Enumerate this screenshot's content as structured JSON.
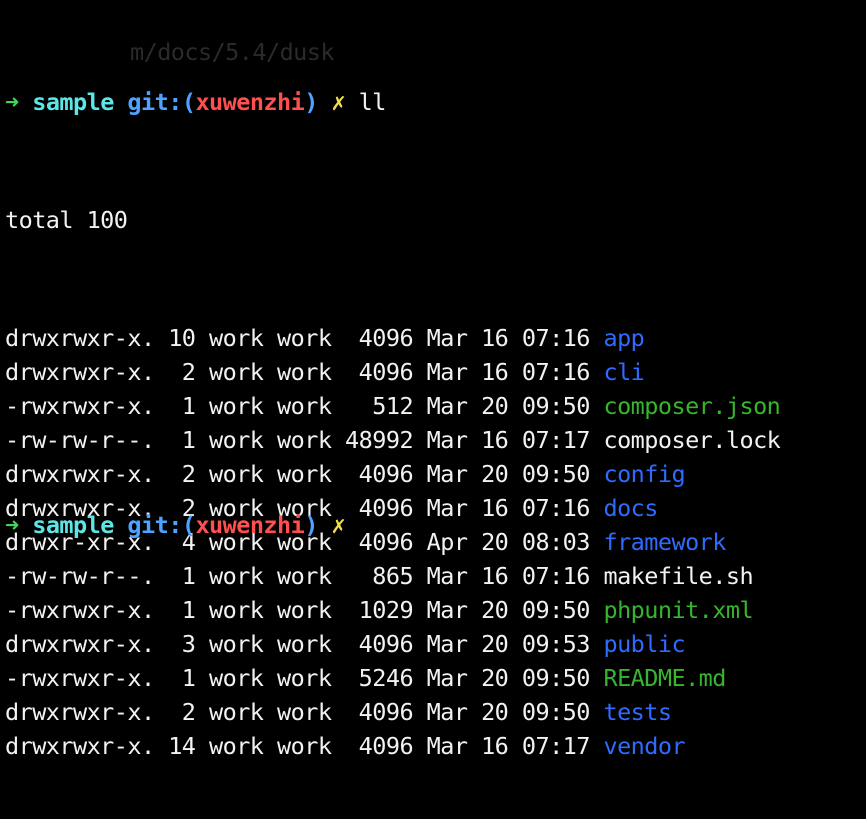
{
  "terminal": {
    "prompt": {
      "arrow": "➜",
      "dir": "sample",
      "git_label": "git:",
      "paren_open": "(",
      "branch": "xuwenzhi",
      "paren_close": ")",
      "dirty_marker": "✗",
      "command": "ll"
    },
    "total_line": "total 100",
    "ghost_text": "m/docs/5.4/dusk",
    "listing": [
      {
        "perm": "drwxrwxr-x.",
        "links": "10",
        "owner": "work",
        "group": "work",
        "size": "4096",
        "month": "Mar",
        "day": "16",
        "time": "07:16",
        "name": "app",
        "type": "dir"
      },
      {
        "perm": "drwxrwxr-x.",
        "links": "2",
        "owner": "work",
        "group": "work",
        "size": "4096",
        "month": "Mar",
        "day": "16",
        "time": "07:16",
        "name": "cli",
        "type": "dir"
      },
      {
        "perm": "-rwxrwxr-x.",
        "links": "1",
        "owner": "work",
        "group": "work",
        "size": "512",
        "month": "Mar",
        "day": "20",
        "time": "09:50",
        "name": "composer.json",
        "type": "exec"
      },
      {
        "perm": "-rw-rw-r--.",
        "links": "1",
        "owner": "work",
        "group": "work",
        "size": "48992",
        "month": "Mar",
        "day": "16",
        "time": "07:17",
        "name": "composer.lock",
        "type": "file"
      },
      {
        "perm": "drwxrwxr-x.",
        "links": "2",
        "owner": "work",
        "group": "work",
        "size": "4096",
        "month": "Mar",
        "day": "20",
        "time": "09:50",
        "name": "config",
        "type": "dir"
      },
      {
        "perm": "drwxrwxr-x.",
        "links": "2",
        "owner": "work",
        "group": "work",
        "size": "4096",
        "month": "Mar",
        "day": "16",
        "time": "07:16",
        "name": "docs",
        "type": "dir"
      },
      {
        "perm": "drwxr-xr-x.",
        "links": "4",
        "owner": "work",
        "group": "work",
        "size": "4096",
        "month": "Apr",
        "day": "20",
        "time": "08:03",
        "name": "framework",
        "type": "dir"
      },
      {
        "perm": "-rw-rw-r--.",
        "links": "1",
        "owner": "work",
        "group": "work",
        "size": "865",
        "month": "Mar",
        "day": "16",
        "time": "07:16",
        "name": "makefile.sh",
        "type": "file"
      },
      {
        "perm": "-rwxrwxr-x.",
        "links": "1",
        "owner": "work",
        "group": "work",
        "size": "1029",
        "month": "Mar",
        "day": "20",
        "time": "09:50",
        "name": "phpunit.xml",
        "type": "exec"
      },
      {
        "perm": "drwxrwxr-x.",
        "links": "3",
        "owner": "work",
        "group": "work",
        "size": "4096",
        "month": "Mar",
        "day": "20",
        "time": "09:53",
        "name": "public",
        "type": "dir"
      },
      {
        "perm": "-rwxrwxr-x.",
        "links": "1",
        "owner": "work",
        "group": "work",
        "size": "5246",
        "month": "Mar",
        "day": "20",
        "time": "09:50",
        "name": "README.md",
        "type": "exec"
      },
      {
        "perm": "drwxrwxr-x.",
        "links": "2",
        "owner": "work",
        "group": "work",
        "size": "4096",
        "month": "Mar",
        "day": "20",
        "time": "09:50",
        "name": "tests",
        "type": "dir"
      },
      {
        "perm": "drwxrwxr-x.",
        "links": "14",
        "owner": "work",
        "group": "work",
        "size": "4096",
        "month": "Mar",
        "day": "16",
        "time": "07:17",
        "name": "vendor",
        "type": "dir"
      }
    ],
    "colors": {
      "background": "#000000",
      "foreground": "#f2f2f2",
      "arrow": "#3fd75a",
      "prompt_dir": "#5ce6e6",
      "git": "#4da3ff",
      "branch": "#ff4f4f",
      "dirty": "#f4e04d",
      "directory": "#2f6bff",
      "executable": "#36b52e"
    }
  }
}
